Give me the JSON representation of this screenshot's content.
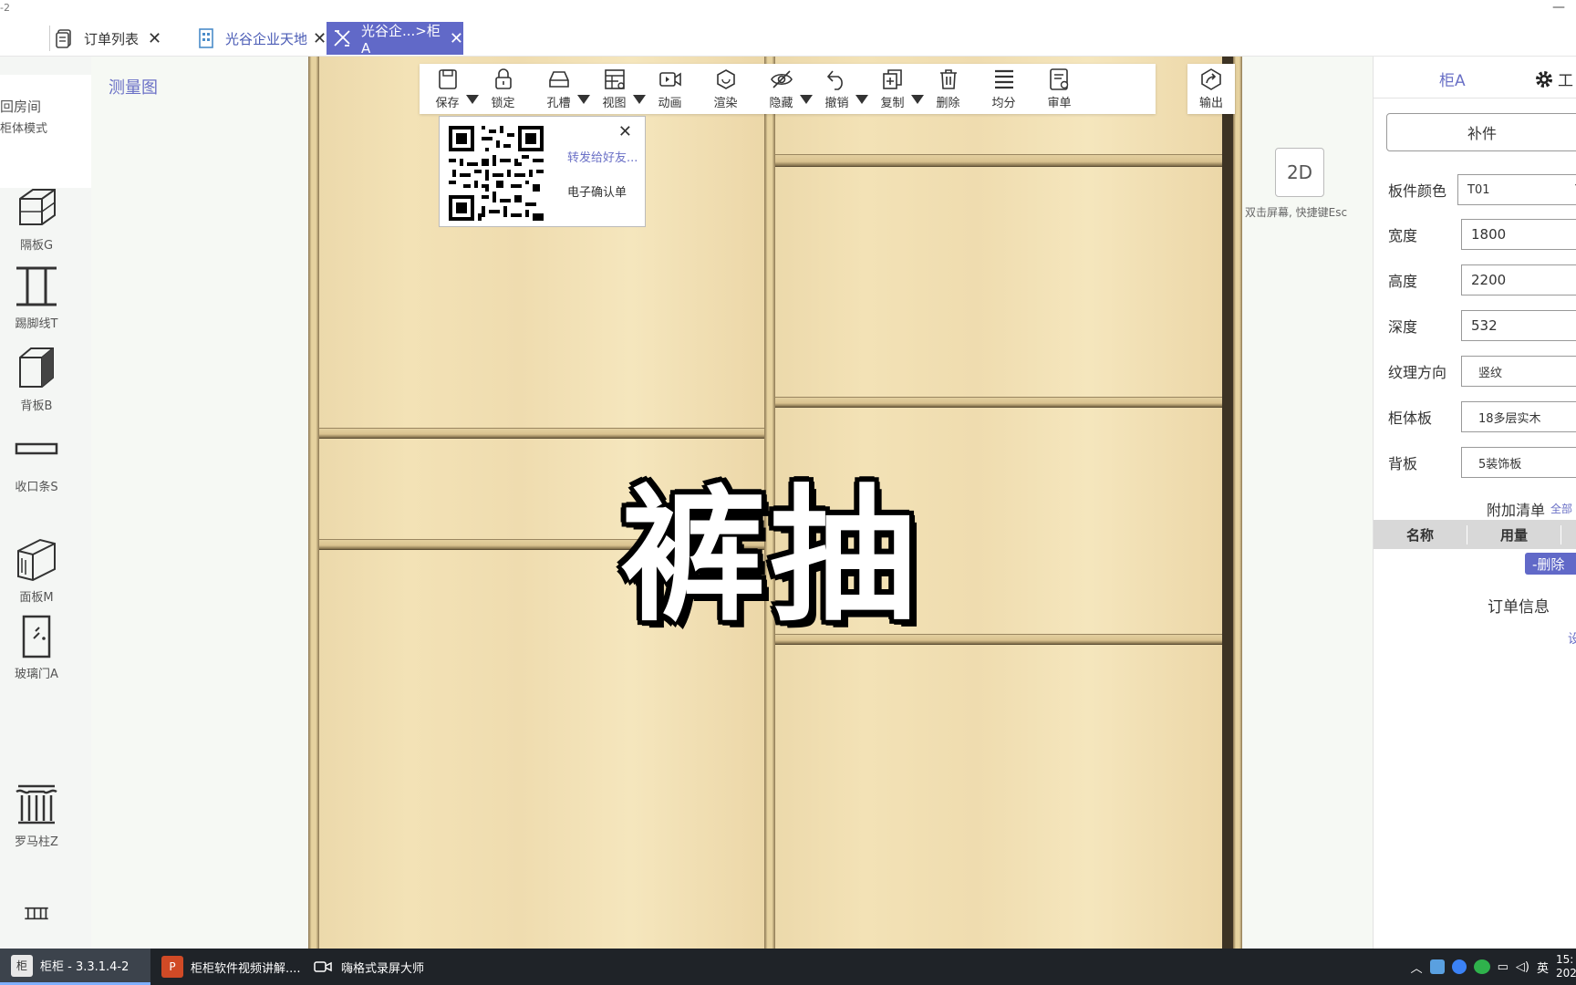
{
  "app": {
    "version_fragment": "-2",
    "minimize_glyph": "—"
  },
  "tabs": {
    "orders": "订单列表",
    "project": "光谷企业天地",
    "cabinet": "光谷企...>柜A",
    "close_glyph": "✕"
  },
  "sidebar": {
    "mode_line1": "回房间",
    "mode_line2": "柜体模式",
    "tools": [
      {
        "label": "隔板G",
        "icon": "partition-board-icon"
      },
      {
        "label": "踢脚线T",
        "icon": "kickboard-icon"
      },
      {
        "label": "背板B",
        "icon": "back-panel-icon"
      },
      {
        "label": "收口条S",
        "icon": "trim-strip-icon"
      },
      {
        "label": "面板M",
        "icon": "face-panel-icon"
      },
      {
        "label": "玻璃门A",
        "icon": "glass-door-icon"
      },
      {
        "label": "罗马柱Z",
        "icon": "roman-column-icon"
      },
      {
        "label": "",
        "icon": "railing-icon"
      }
    ]
  },
  "canvas": {
    "measure_link": "测量图",
    "caption": "裤抽",
    "btn_2d": "2D",
    "hint": "双击屏幕, 快捷键Esc"
  },
  "toolbar": {
    "buttons": [
      {
        "label": "保存",
        "icon": "save-icon",
        "dropdown": true
      },
      {
        "label": "锁定",
        "icon": "lock-icon",
        "dropdown": false
      },
      {
        "label": "孔槽",
        "icon": "slot-icon",
        "dropdown": true
      },
      {
        "label": "视图",
        "icon": "view-icon",
        "dropdown": true
      },
      {
        "label": "动画",
        "icon": "animation-icon",
        "dropdown": false
      },
      {
        "label": "渲染",
        "icon": "render-icon",
        "dropdown": false
      },
      {
        "label": "隐藏",
        "icon": "hide-icon",
        "dropdown": true
      },
      {
        "label": "撤销",
        "icon": "undo-icon",
        "dropdown": true
      },
      {
        "label": "复制",
        "icon": "copy-icon",
        "dropdown": true
      },
      {
        "label": "删除",
        "icon": "delete-icon",
        "dropdown": false
      },
      {
        "label": "均分",
        "icon": "distribute-icon",
        "dropdown": false
      },
      {
        "label": "审单",
        "icon": "review-icon",
        "dropdown": false
      }
    ],
    "output_label": "输出"
  },
  "qr_popup": {
    "share": "转发给好友...",
    "confirm": "电子确认单",
    "close_glyph": "✕"
  },
  "right_panel": {
    "tab_cabinet": "柜A",
    "tab_tool": "工",
    "addon_button": "补件",
    "fields": [
      {
        "label": "板件颜色",
        "value": "T01",
        "dropdown": true,
        "small": false
      },
      {
        "label": "宽度",
        "value": "1800",
        "dropdown": false,
        "small": false
      },
      {
        "label": "高度",
        "value": "2200",
        "dropdown": false,
        "small": false
      },
      {
        "label": "深度",
        "value": "532",
        "dropdown": false,
        "small": false
      },
      {
        "label": "纹理方向",
        "value": "竖纹",
        "dropdown": false,
        "small": true
      },
      {
        "label": "柜体板",
        "value": "18多层实木",
        "dropdown": false,
        "small": true
      },
      {
        "label": "背板",
        "value": "5装饰板",
        "dropdown": false,
        "small": true
      }
    ],
    "extra_title": "附加清单",
    "extra_all": "全部",
    "col_name": "名称",
    "col_usage": "用量",
    "delete_button": "-删除",
    "order_info": "订单信息",
    "order_set": "设"
  },
  "taskbar": {
    "task1": "柜柜 - 3.3.1.4-2",
    "task2": "柜柜软件视频讲解....",
    "task3": "嗨格式录屏大师",
    "ime": "英",
    "time": "15:",
    "date": "202"
  },
  "colors": {
    "accent": "#6169c8",
    "link": "#6a70c6",
    "wood": "#efdcaf"
  }
}
